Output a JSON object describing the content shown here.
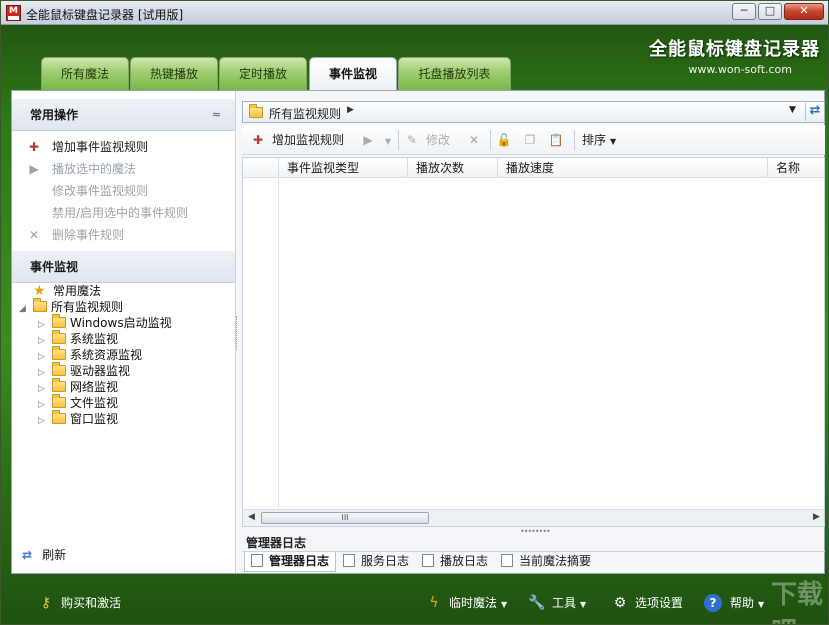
{
  "window": {
    "title": "全能鼠标键盘记录器 [试用版]",
    "app_icon_letter": "M",
    "min_label": "─",
    "max_label": "□",
    "close_label": "✕"
  },
  "brand": {
    "title": "全能鼠标键盘记录器",
    "url": "www.won-soft.com"
  },
  "tabs": [
    "所有魔法",
    "热键播放",
    "定时播放",
    "事件监视",
    "托盘播放列表"
  ],
  "active_tab": "事件监视",
  "left_panel": {
    "common_ops_title": "常用操作",
    "collapse_glyph": "≈",
    "ops": [
      {
        "label": "增加事件监视规则",
        "enabled": true
      },
      {
        "label": "播放选中的魔法",
        "enabled": false
      },
      {
        "label": "修改事件监视规则",
        "enabled": false
      },
      {
        "label": "禁用/启用选中的事件规则",
        "enabled": false
      },
      {
        "label": "删除事件规则",
        "enabled": false
      }
    ],
    "event_monitor_title": "事件监视",
    "tree": {
      "favorites": "常用魔法",
      "root": "所有监视规则",
      "children": [
        "Windows启动监视",
        "系统监视",
        "系统资源监视",
        "驱动器监视",
        "网络监视",
        "文件监视",
        "窗口监视"
      ]
    },
    "refresh_label": "刷新"
  },
  "right_panel": {
    "path": "所有监视规则",
    "toolbar": {
      "add": "增加监视规则",
      "edit": "修改",
      "sort": "排序"
    },
    "columns": [
      "事件监视类型",
      "播放次数",
      "播放速度",
      "名称"
    ],
    "log_title": "管理器日志",
    "log_tabs": [
      "管理器日志",
      "服务日志",
      "播放日志",
      "当前魔法摘要"
    ],
    "active_log_tab": "管理器日志"
  },
  "bottom_bar": {
    "buy": "购买和激活",
    "temp_magic": "临时魔法",
    "tools": "工具",
    "settings": "选项设置",
    "help": "帮助"
  },
  "watermark": "下载吧",
  "colors": {
    "theme_green": "#2f7a18",
    "accent_blue": "#2f6fd0"
  }
}
